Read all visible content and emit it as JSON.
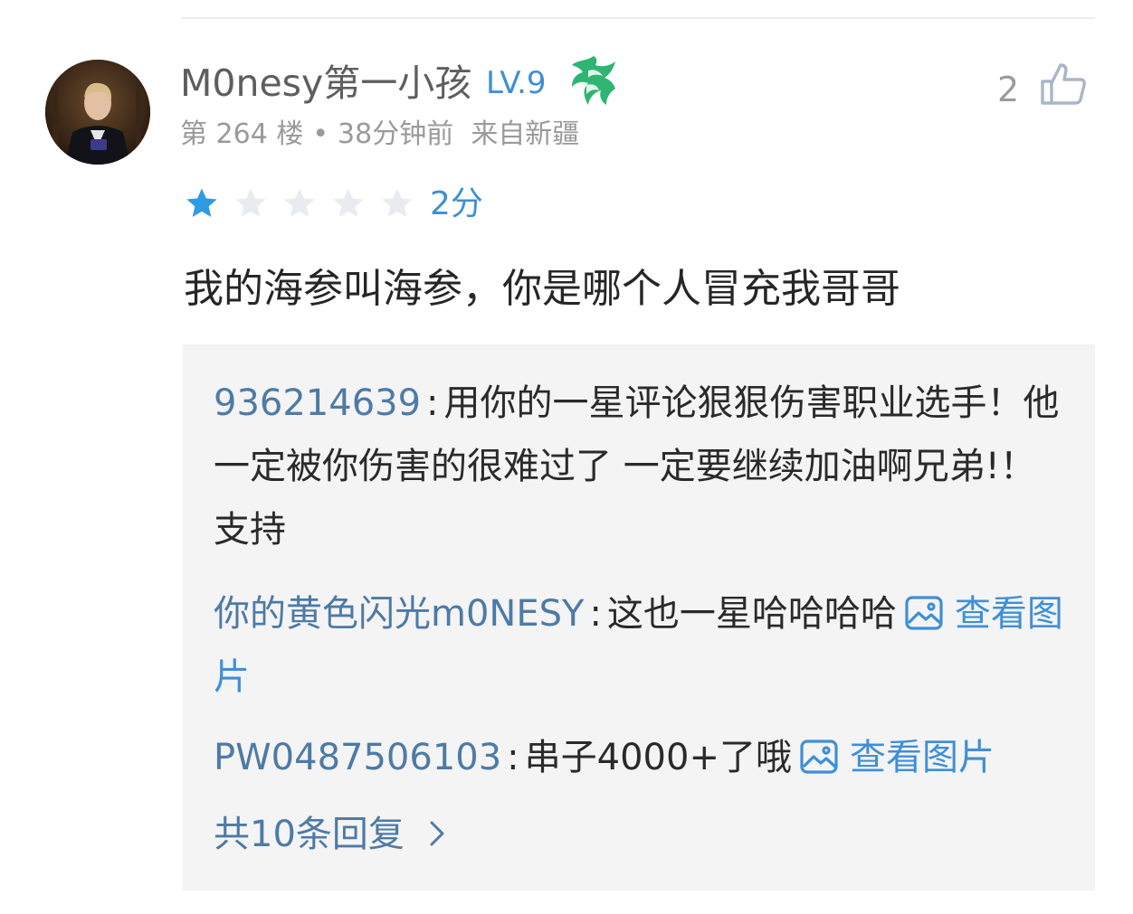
{
  "comment": {
    "username": "M0nesy第一小孩",
    "level": "LV.9",
    "floor": "第 264 楼",
    "time": "38分钟前",
    "location": "来自新疆",
    "separator": "•",
    "like_count": "2",
    "rating_stars": 1,
    "rating_max": 5,
    "score_text": "2分",
    "text": "我的海参叫海参，你是哪个人冒充我哥哥"
  },
  "replies": [
    {
      "name": "936214639",
      "text": "用你的一星评论狠狠伤害职业选手！他一定被你伤害的很难过了 一定要继续加油啊兄弟!！支持",
      "image_link": ""
    },
    {
      "name": "你的黄色闪光m0NESY",
      "text": "这也一星哈哈哈哈",
      "image_link": "查看图片"
    },
    {
      "name": "PW0487506103",
      "text": "串子4000+了哦",
      "image_link": "查看图片"
    }
  ],
  "colon": ":",
  "more_replies": "共10条回复",
  "icons": {
    "like": "thumbs-up-icon",
    "image": "image-icon",
    "chevron": "chevron-right-icon",
    "team_logo": "team-logo-icon",
    "star_filled": "star-filled-icon",
    "star_empty": "star-empty-icon"
  },
  "colors": {
    "accent": "#3f8fd6",
    "reply_name": "#4e7aa6",
    "star_filled": "#2f9be3",
    "star_empty": "#e8ecf1",
    "reply_bg": "#f4f4f4"
  }
}
